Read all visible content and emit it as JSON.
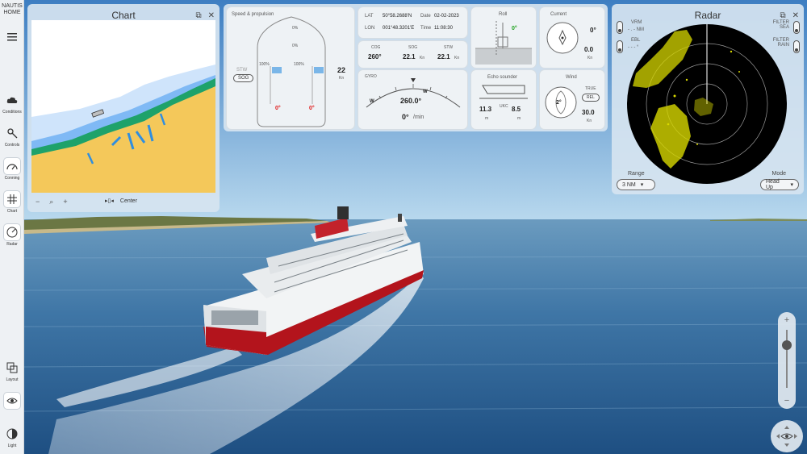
{
  "sidebar": {
    "brand": [
      "NAUTIS",
      "HOME"
    ],
    "items": [
      {
        "label": "Conditions",
        "icon": "cloud-icon"
      },
      {
        "label": "Controls",
        "icon": "helm-icon"
      },
      {
        "label": "Conning",
        "icon": "gauge-icon"
      },
      {
        "label": "Chart",
        "icon": "grid-icon"
      },
      {
        "label": "Radar",
        "icon": "radar-icon"
      }
    ],
    "bottom_items": [
      {
        "label": "Layout",
        "icon": "layout-icon"
      },
      {
        "label": "View",
        "icon": "eye-icon"
      },
      {
        "label": "Light",
        "icon": "contrast-icon"
      }
    ]
  },
  "chart_panel": {
    "title": "Chart",
    "footer": {
      "minus": "−",
      "plus": "+",
      "center_label": "Center"
    }
  },
  "conning": {
    "speed": {
      "title": "Speed & propulsion",
      "top_pct1": "0%",
      "top_pct2": "0%",
      "left_pct": "100%",
      "right_pct": "100%",
      "stw_label": "STW",
      "sog_chip": "SOG",
      "speed_value": "22",
      "speed_unit": "Kn",
      "rudder_left": "0°",
      "rudder_right": "0°"
    },
    "position": {
      "lat_label": "LAT",
      "lat_value": "50°58.2688'N",
      "lon_label": "LON",
      "lon_value": "001°48.3201'E",
      "date_label": "Date",
      "date_value": "02-02-2023",
      "time_label": "Time",
      "time_value": "11:08:30"
    },
    "course": {
      "cog_label": "COG",
      "cog_value": "260°",
      "sog_label": "SOG",
      "sog_value": "22.1",
      "sog_unit": "Kn",
      "stw_label": "STW",
      "stw_value": "22.1",
      "stw_unit": "Kn"
    },
    "gyro": {
      "label": "GYRO",
      "heading": "260.0°",
      "rot": "0°",
      "rot_unit": "/min",
      "w1": "W",
      "w2": "W"
    },
    "roll": {
      "label": "Roll",
      "value": "0°"
    },
    "current": {
      "label": "Current",
      "dir": "0°",
      "speed": "0.0",
      "unit": "Kn"
    },
    "echo": {
      "label": "Echo sounder",
      "depth": "11.3",
      "ukc_label": "UKC",
      "ukc": "8.5",
      "unit1": "m",
      "unit2": "m"
    },
    "wind": {
      "label": "Wind",
      "true_label": "TRUE",
      "rel_chip": "REL",
      "dir": "2°",
      "speed": "30.0",
      "unit": "Kn"
    }
  },
  "radar_panel": {
    "title": "Radar",
    "vrm_label": "VRM",
    "vrm_value": "- . - NM",
    "ebl_label": "EBL",
    "ebl_value": "- - - °",
    "filter_sea": [
      "FILTER",
      "SEA"
    ],
    "filter_rain": [
      "FILTER",
      "RAIN"
    ],
    "range_label": "Range",
    "range_value": "3 NM",
    "mode_label": "Mode",
    "mode_value": "Head Up"
  },
  "zoom": {
    "plus": "+",
    "minus": "−"
  },
  "colors": {
    "panel": "#d6e4f0",
    "card": "#eef2f5",
    "radar_echo": "#d8d800",
    "sea": "#4d7fa6",
    "hull_red": "#b3141c",
    "land_chart": "#f4c85a",
    "green": "#1aa01a",
    "red": "#e01818"
  }
}
